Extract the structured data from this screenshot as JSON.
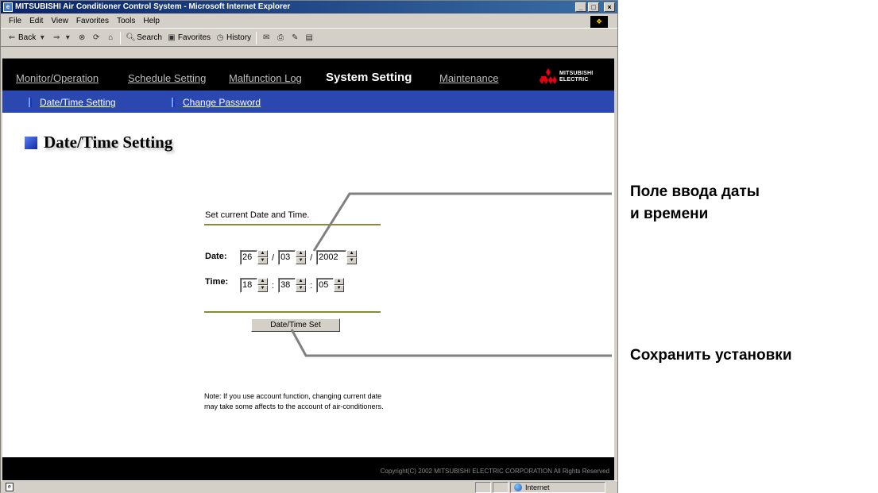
{
  "browser": {
    "title": "MITSUBISHI Air Conditioner Control System - Microsoft Internet Explorer",
    "window_buttons": [
      "_",
      "□",
      "×"
    ],
    "menu": [
      {
        "label": "File",
        "key": "F"
      },
      {
        "label": "Edit",
        "key": "E"
      },
      {
        "label": "View",
        "key": "V"
      },
      {
        "label": "Favorites",
        "key": "a"
      },
      {
        "label": "Tools",
        "key": "T"
      },
      {
        "label": "Help",
        "key": "H"
      }
    ],
    "toolbar": {
      "back": "Back",
      "search": "Search",
      "favorites": "Favorites",
      "history": "History"
    },
    "status": {
      "zone": "Internet"
    }
  },
  "nav": {
    "items": [
      {
        "label": "Monitor/Operation",
        "active": false
      },
      {
        "label": "Schedule Setting",
        "active": false
      },
      {
        "label": "Malfunction Log",
        "active": false
      },
      {
        "label": "System Setting",
        "active": true
      },
      {
        "label": "Maintenance",
        "active": false
      }
    ],
    "logo": {
      "line1": "MITSUBISHI",
      "line2": "ELECTRIC"
    }
  },
  "subnav": {
    "items": [
      {
        "label": "Date/Time Setting"
      },
      {
        "label": "Change Password"
      }
    ]
  },
  "page": {
    "title": "Date/Time Setting",
    "intro": "Set current Date and Time.",
    "date": {
      "label": "Date:",
      "day": "26",
      "month": "03",
      "year": "2002",
      "separator": "/"
    },
    "time": {
      "label": "Time:",
      "hour": "18",
      "minute": "38",
      "second": "05",
      "separator": ":"
    },
    "set_button": "Date/Time Set",
    "note_line1": "Note: If you use account function, changing current date",
    "note_line2": "may take some affects to the account of air-conditioners.",
    "copyright": "Copyright(C) 2002 MITSUBISHI ELECTRIC CORPORATION All Rights Reserved"
  },
  "annotations": {
    "field_label_line1": "Поле ввода даты",
    "field_label_line2": "и времени",
    "save_label": "Сохранить установки"
  },
  "colors": {
    "nav_bg": "#000000",
    "subnav_bg": "#2b48b0",
    "rule": "#8a8a3a",
    "logo_red": "#e60012"
  }
}
